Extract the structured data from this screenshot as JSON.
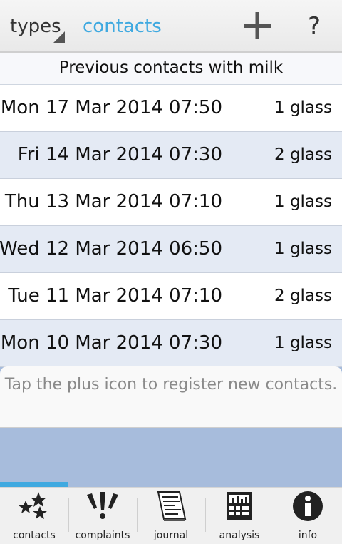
{
  "topbar": {
    "types_label": "types",
    "contacts_tab": "contacts",
    "add_icon": "plus-icon",
    "help_label": "?"
  },
  "list": {
    "header": "Previous contacts with milk",
    "rows": [
      {
        "datetime": "Mon 17 Mar 2014 07:50",
        "amount": "1 glass"
      },
      {
        "datetime": "Fri 14 Mar 2014 07:30",
        "amount": "2 glass"
      },
      {
        "datetime": "Thu 13 Mar 2014 07:10",
        "amount": "1 glass"
      },
      {
        "datetime": "Wed 12 Mar 2014 06:50",
        "amount": "1 glass"
      },
      {
        "datetime": "Tue 11 Mar 2014 07:10",
        "amount": "2 glass"
      },
      {
        "datetime": "Mon 10 Mar 2014 07:30",
        "amount": "1 glass"
      }
    ]
  },
  "hint": "Tap the plus icon to register new contacts.",
  "bottom_nav": [
    {
      "label": "contacts",
      "icon": "stars-icon"
    },
    {
      "label": "complaints",
      "icon": "exclamation-icon"
    },
    {
      "label": "journal",
      "icon": "journal-icon"
    },
    {
      "label": "analysis",
      "icon": "chart-icon"
    },
    {
      "label": "info",
      "icon": "info-icon"
    }
  ],
  "colors": {
    "accent": "#3fa9e0",
    "row_alt": "#e4eaf4",
    "background": "#a7bcdc"
  }
}
